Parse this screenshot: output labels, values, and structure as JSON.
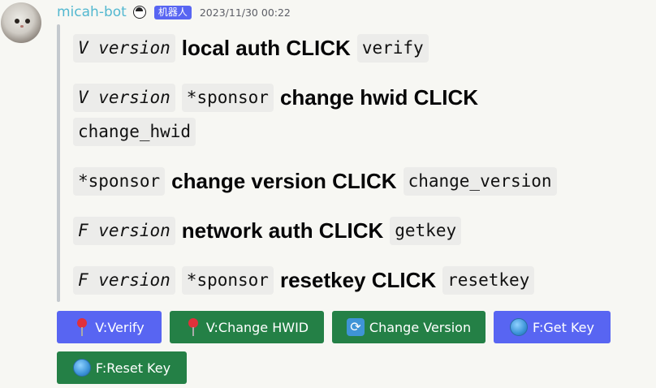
{
  "message": {
    "username": "micah-bot",
    "bot_tag": "机器人",
    "timestamp": "2023/11/30 00:22"
  },
  "lines": [
    {
      "parts": [
        {
          "code": "V version",
          "italic": true
        },
        {
          "text": "local auth CLICK"
        },
        {
          "code": "verify"
        }
      ]
    },
    {
      "parts": [
        {
          "code": "V version",
          "italic": true
        },
        {
          "code": "*sponsor"
        },
        {
          "text": "change hwid CLICK"
        }
      ]
    },
    {
      "parts": [
        {
          "code": "change_hwid"
        }
      ]
    },
    {
      "parts": [
        {
          "code": "*sponsor"
        },
        {
          "text": "change version CLICK"
        },
        {
          "code": "change_version"
        }
      ]
    },
    {
      "parts": [
        {
          "code": "F version",
          "italic": true
        },
        {
          "text": "network auth CLICK"
        },
        {
          "code": "getkey"
        }
      ]
    },
    {
      "parts": [
        {
          "code": "F version",
          "italic": true
        },
        {
          "code": "*sponsor"
        },
        {
          "text": "resetkey CLICK"
        },
        {
          "code": "resetkey"
        }
      ]
    }
  ],
  "buttons": [
    {
      "label": "V:Verify",
      "icon": "pin-icon",
      "color": "#5865f2"
    },
    {
      "label": "V:Change HWID",
      "icon": "pin-icon",
      "color": "#248046"
    },
    {
      "label": "Change Version",
      "icon": "refresh-icon",
      "color": "#248046"
    },
    {
      "label": "F:Get Key",
      "icon": "globe-icon",
      "color": "#5865f2"
    },
    {
      "label": "F:Reset Key",
      "icon": "globe-icon",
      "color": "#248046"
    }
  ]
}
